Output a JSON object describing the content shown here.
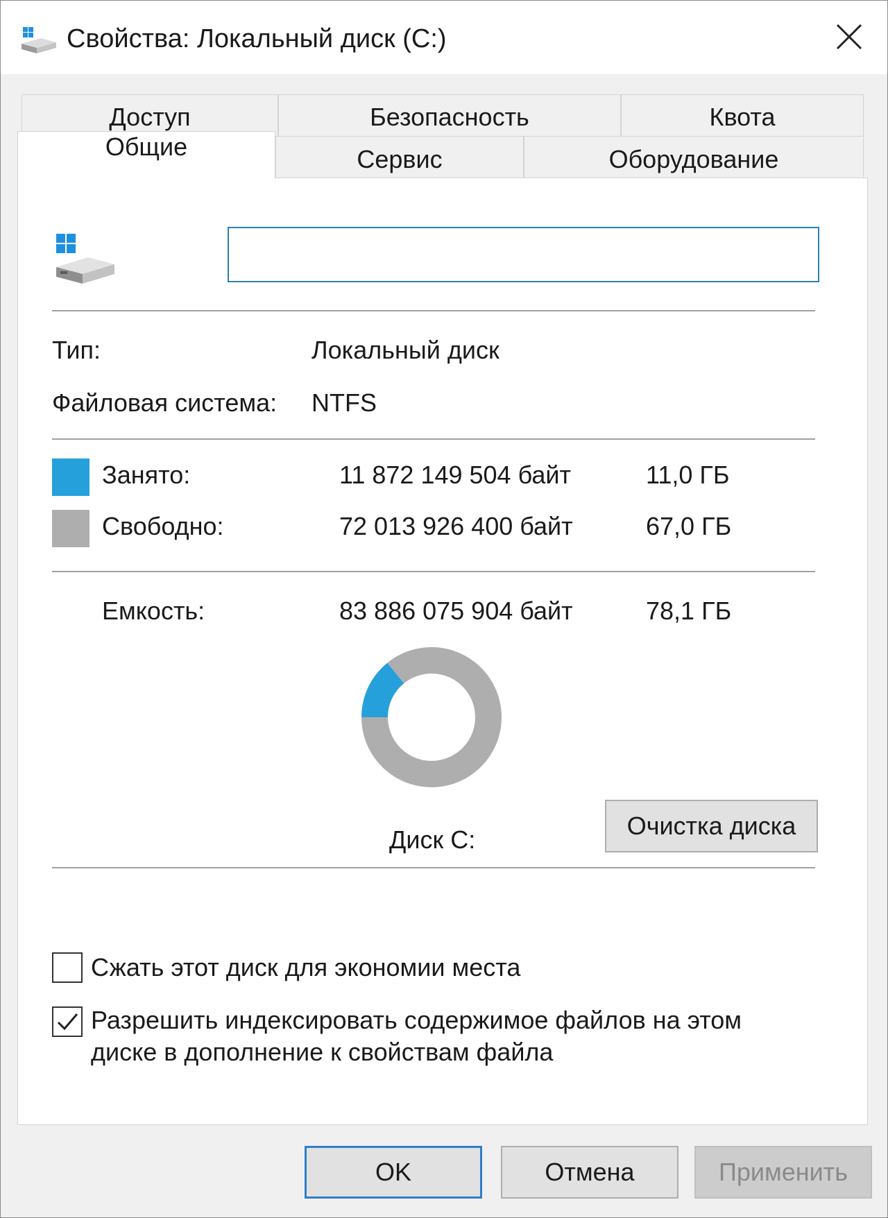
{
  "window": {
    "title": "Свойства: Локальный диск (C:)"
  },
  "tabs": {
    "row1": [
      "Доступ",
      "Безопасность",
      "Квота"
    ],
    "row2": [
      "Общие",
      "Сервис",
      "Оборудование"
    ],
    "active": "Общие"
  },
  "general": {
    "volume_label": "",
    "type_label": "Тип:",
    "type_value": "Локальный диск",
    "fs_label": "Файловая система:",
    "fs_value": "NTFS",
    "used_label": "Занято:",
    "used_bytes": "11 872 149 504 байт",
    "used_size": "11,0 ГБ",
    "free_label": "Свободно:",
    "free_bytes": "72 013 926 400 байт",
    "free_size": "67,0 ГБ",
    "capacity_label": "Емкость:",
    "capacity_bytes": "83 886 075 904 байт",
    "capacity_size": "78,1 ГБ",
    "disk_caption": "Диск C:",
    "cleanup_button": "Очистка диска",
    "compress_label": "Сжать этот диск для экономии места",
    "compress_checked": false,
    "index_label_line1": "Разрешить индексировать содержимое файлов на этом",
    "index_label_line2": "диске в дополнение к свойствам файла",
    "index_checked": true
  },
  "colors": {
    "used": "#26a0da",
    "free": "#aeaeae"
  },
  "chart_data": {
    "type": "pie",
    "categories": [
      "Занято",
      "Свободно"
    ],
    "values": [
      11872149504,
      72013926400
    ]
  },
  "footer": {
    "ok": "OK",
    "cancel": "Отмена",
    "apply": "Применить"
  }
}
